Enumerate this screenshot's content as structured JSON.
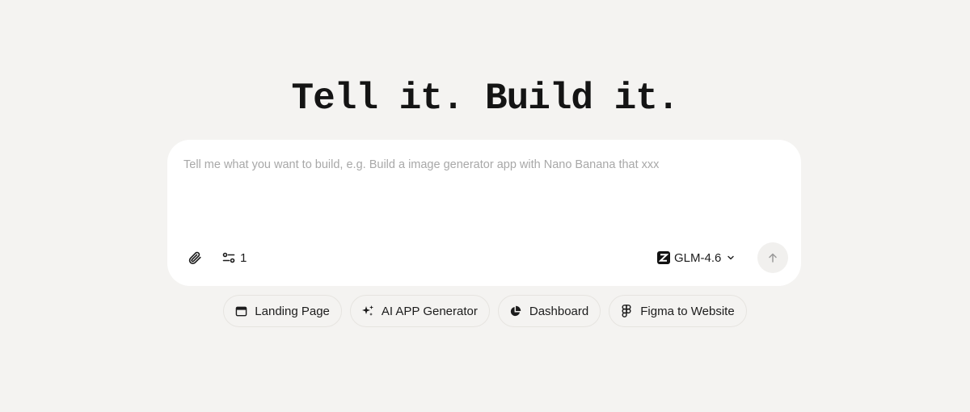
{
  "hero": {
    "title": "Tell it. Build it."
  },
  "composer": {
    "placeholder": "Tell me what you want to build, e.g. Build a image generator app with Nano Banana that xxx",
    "value": "",
    "attach_icon": "paperclip-icon",
    "settings_icon": "sliders-icon",
    "settings_count": "1",
    "model": {
      "logo_icon": "zhipu-z-logo-icon",
      "name": "GLM-4.6",
      "dropdown_icon": "chevron-down-icon"
    },
    "send_icon": "arrow-up-icon"
  },
  "chips": [
    {
      "label": "Landing Page",
      "icon": "browser-window-icon"
    },
    {
      "label": "AI APP Generator",
      "icon": "sparkles-icon"
    },
    {
      "label": "Dashboard",
      "icon": "pie-chart-icon"
    },
    {
      "label": "Figma to Website",
      "icon": "figma-icon"
    }
  ],
  "colors": {
    "background": "#f4f3f1",
    "card": "#ffffff",
    "text": "#1c1c1c",
    "placeholder": "#a8a8a8",
    "send_button_bg": "#f1f0ee"
  }
}
